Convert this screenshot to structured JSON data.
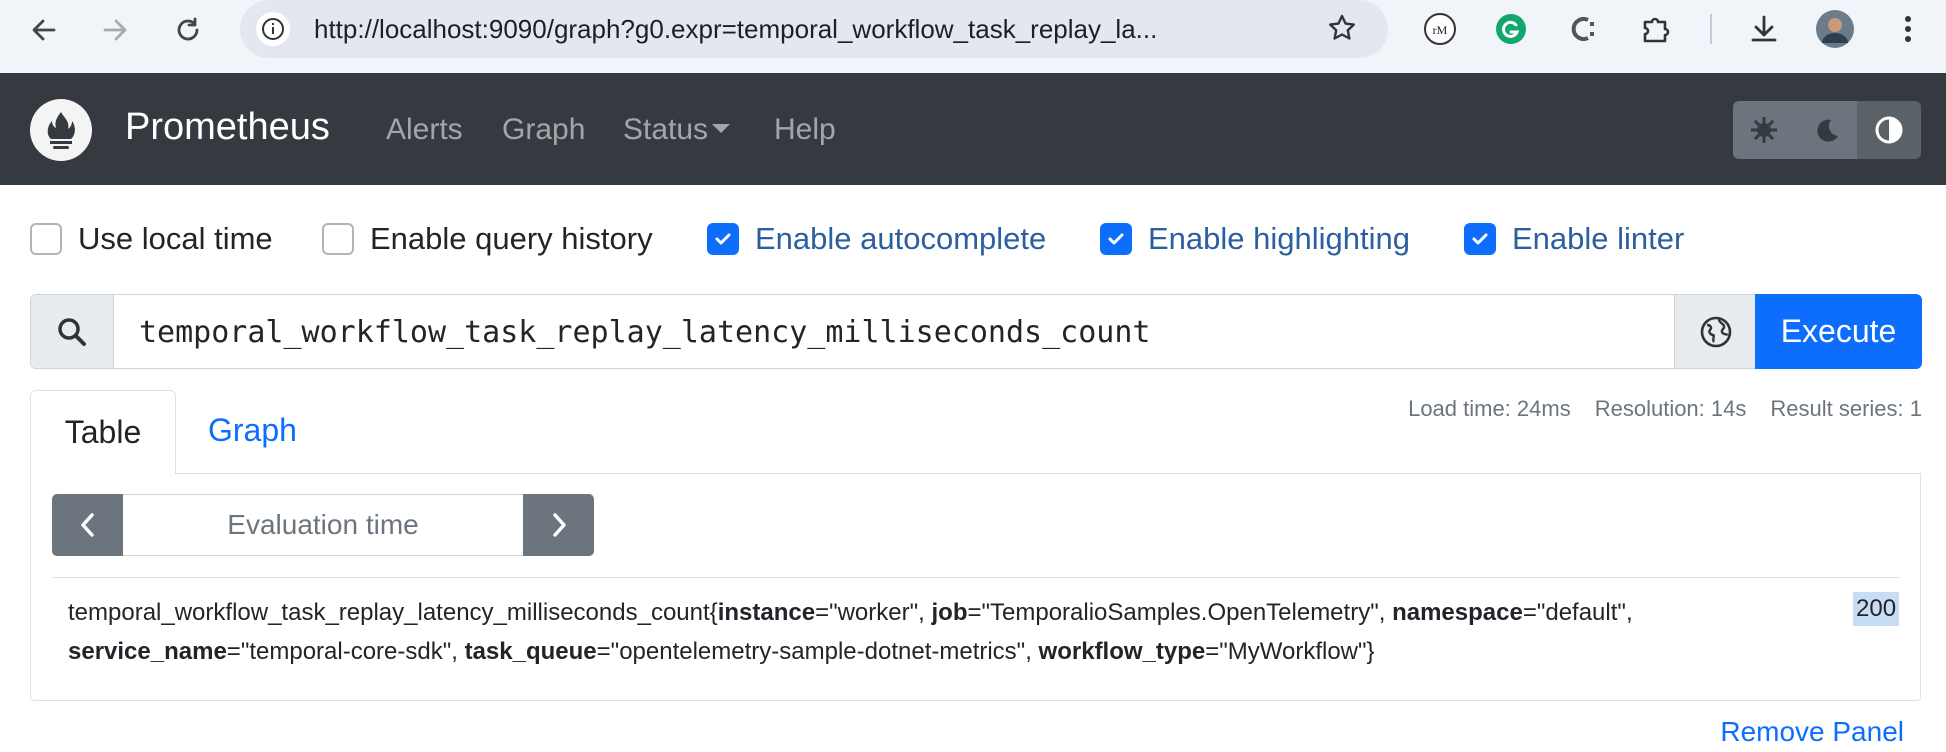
{
  "browser": {
    "url": "http://localhost:9090/graph?g0.expr=temporal_workflow_task_replay_la..."
  },
  "navbar": {
    "brand": "Prometheus",
    "links": [
      "Alerts",
      "Graph",
      "Status",
      "Help"
    ]
  },
  "options": [
    {
      "label": "Use local time",
      "checked": false
    },
    {
      "label": "Enable query history",
      "checked": false
    },
    {
      "label": "Enable autocomplete",
      "checked": true
    },
    {
      "label": "Enable highlighting",
      "checked": true
    },
    {
      "label": "Enable linter",
      "checked": true
    }
  ],
  "query": {
    "expression": "temporal_workflow_task_replay_latency_milliseconds_count",
    "execute_label": "Execute"
  },
  "tabs": {
    "table": "Table",
    "graph": "Graph"
  },
  "stats": {
    "load_time": "Load time: 24ms",
    "resolution": "Resolution: 14s",
    "result_series": "Result series: 1"
  },
  "table": {
    "eval_placeholder": "Evaluation time",
    "metric_name": "temporal_workflow_task_replay_latency_milliseconds_count",
    "labels": [
      {
        "key": "instance",
        "value": "\"worker\""
      },
      {
        "key": "job",
        "value": "\"TemporalioSamples.OpenTelemetry\""
      },
      {
        "key": "namespace",
        "value": "\"default\""
      },
      {
        "key": "service_name",
        "value": "\"temporal-core-sdk\""
      },
      {
        "key": "task_queue",
        "value": "\"opentelemetry-sample-dotnet-metrics\""
      },
      {
        "key": "workflow_type",
        "value": "\"MyWorkflow\""
      }
    ],
    "value": "200"
  },
  "panel": {
    "remove_label": "Remove Panel"
  }
}
